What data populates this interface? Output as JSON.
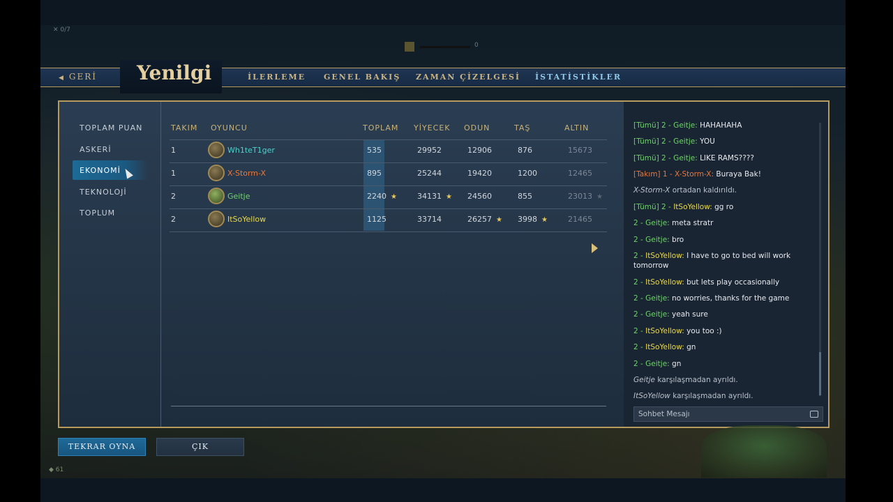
{
  "hud": {
    "pop": "0/7",
    "res_value": "0",
    "bottom_count": "61"
  },
  "header": {
    "back_label": "GERİ",
    "title": "Yenilgi",
    "tabs": [
      "İLERLEME",
      "GENEL BAKIŞ",
      "ZAMAN ÇİZELGESİ",
      "İSTATİSTİKLER"
    ],
    "active_tab": "İSTATİSTİKLER"
  },
  "categories": [
    "TOPLAM PUAN",
    "ASKERİ",
    "EKONOMİ",
    "TEKNOLOJİ",
    "TOPLUM"
  ],
  "active_category": "EKONOMİ",
  "table": {
    "headers": [
      "TAKIM",
      "OYUNCU",
      "TOPLAM",
      "YİYECEK",
      "ODUN",
      "TAŞ",
      "ALTIN"
    ],
    "rows": [
      {
        "team": "1",
        "player": "Wh1teT1ger",
        "color": "#4fd0c8",
        "toplam": "535",
        "yiyecek": "29952",
        "odun": "12906",
        "tas": "876",
        "altin": "15673"
      },
      {
        "team": "1",
        "player": "X-Storm-X",
        "color": "#e8773b",
        "toplam": "895",
        "yiyecek": "25244",
        "odun": "19420",
        "tas": "1200",
        "altin": "12465"
      },
      {
        "team": "2",
        "player": "Geitje",
        "color": "#6fd26a",
        "toplam": "2240",
        "yiyecek": "34131",
        "odun": "24560",
        "tas": "855",
        "altin": "23013"
      },
      {
        "team": "2",
        "player": "ItSoYellow",
        "color": "#e9d84a",
        "toplam": "1125",
        "yiyecek": "33714",
        "odun": "26257",
        "tas": "3998",
        "altin": "21465"
      }
    ]
  },
  "chat": {
    "messages": [
      {
        "prefix": "[Tümü] 2 - Geitje:",
        "style": "t",
        "text": " HAHAHAHA"
      },
      {
        "prefix": "[Tümü] 2 - Geitje:",
        "style": "t",
        "text": " YOU"
      },
      {
        "prefix": "[Tümü] 2 - Geitje:",
        "style": "t",
        "text": " LIKE RAMS????"
      },
      {
        "prefix": "[Takım] 1 - X-Storm-X:",
        "style": "o",
        "text": " Buraya Bak!"
      },
      {
        "sys_name": "X-Storm-X",
        "text": " ortadan kaldırıldı."
      },
      {
        "prefix": "[Tümü] 2 - ",
        "name": "ItSoYellow:",
        "style": "t",
        "text": " gg ro"
      },
      {
        "prefix": "2 - Geitje:",
        "style": "t",
        "text": " meta stratr"
      },
      {
        "prefix": "2 - Geitje:",
        "style": "t",
        "text": " bro"
      },
      {
        "prefix": "2 - ",
        "name": "ItSoYellow:",
        "style": "t",
        "text": " I have to go to bed will work tomorrow"
      },
      {
        "prefix": "2 - ",
        "name": "ItSoYellow:",
        "style": "t",
        "text": " but lets play occasionally"
      },
      {
        "prefix": "2 - Geitje:",
        "style": "t",
        "text": " no worries, thanks for the game"
      },
      {
        "prefix": "2 - Geitje:",
        "style": "t",
        "text": " yeah sure"
      },
      {
        "prefix": "2 - ",
        "name": "ItSoYellow:",
        "style": "t",
        "text": " you too :)"
      },
      {
        "prefix": "2 - ",
        "name": "ItSoYellow:",
        "style": "t",
        "text": " gn"
      },
      {
        "prefix": "2 - Geitje:",
        "style": "t",
        "text": " gn"
      },
      {
        "sys_name": "Geitje",
        "text": " karşılaşmadan ayrıldı."
      },
      {
        "sys_name": "ItSoYellow",
        "text": " karşılaşmadan ayrıldı."
      }
    ],
    "input_placeholder": "Sohbet Mesajı"
  },
  "buttons": {
    "replay": "TEKRAR OYNA",
    "exit": "ÇIK"
  }
}
